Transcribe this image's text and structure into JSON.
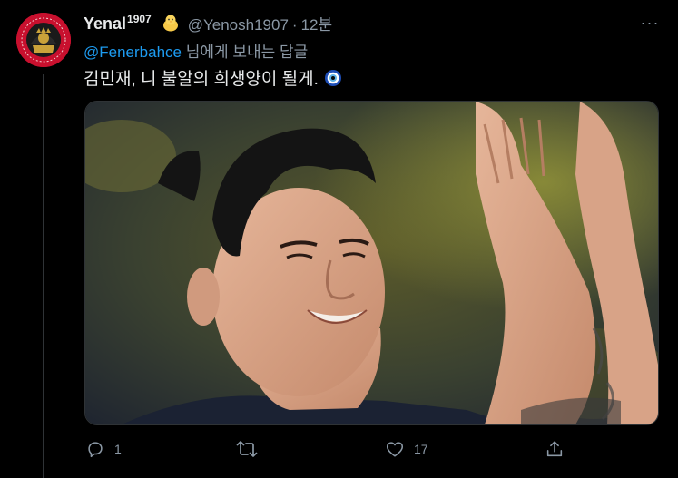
{
  "tweet": {
    "display_name": "Yenal",
    "display_name_sup": "1907",
    "handle": "@Yenosh1907",
    "separator": "·",
    "time": "12분",
    "reply_to_handle": "@Fenerbahce",
    "reply_to_suffix": " 님에게 보내는 답글",
    "text": "김민재, 니 불알의 희생양이 될게.",
    "more_label": "···"
  },
  "actions": {
    "reply_count": "1",
    "retweet_count": "",
    "like_count": "17"
  },
  "colors": {
    "background": "#000000",
    "accent": "#1d9bf0",
    "muted": "#8b98a5",
    "text": "#e7e9ea",
    "avatar_red": "#c8102e"
  },
  "icons": [
    "reply-icon",
    "retweet-icon",
    "like-icon",
    "share-icon",
    "more-icon",
    "chick-emoji-icon",
    "nazar-emoji-icon"
  ]
}
